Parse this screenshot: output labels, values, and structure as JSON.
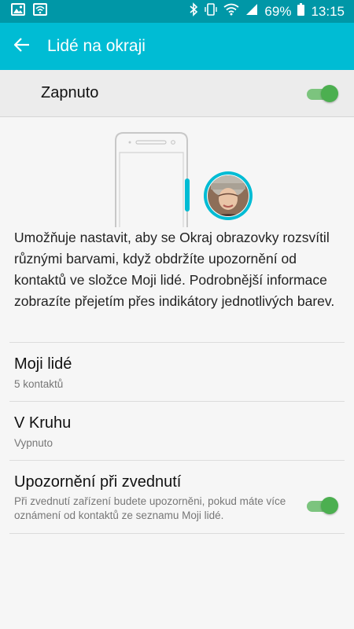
{
  "statusbar": {
    "battery": "69%",
    "time": "13:15"
  },
  "appbar": {
    "title": "Lidé na okraji"
  },
  "master_switch": {
    "label": "Zapnuto",
    "on": true
  },
  "description": "Umožňuje nastavit, aby se Okraj obrazovky rozsvítil různými barvami, když obdržíte upozornění od kontaktů ve složce Moji lidé. Podrobnější informace zobrazíte přejetím přes indikátory jednotlivých barev.",
  "items": [
    {
      "title": "Moji lidé",
      "subtitle": "5 kontaktů"
    },
    {
      "title": "V Kruhu",
      "subtitle": "Vypnuto"
    }
  ],
  "pickup_alert": {
    "title": "Upozornění při zvednutí",
    "subtitle": "Při zvednutí zařízení budete upozorněni, pokud máte více oznámení od kontaktů ze seznamu Moji lidé.",
    "on": true
  },
  "colors": {
    "statusbar": "#0097a7",
    "appbar": "#00bcd4",
    "accent": "#4caf50"
  }
}
